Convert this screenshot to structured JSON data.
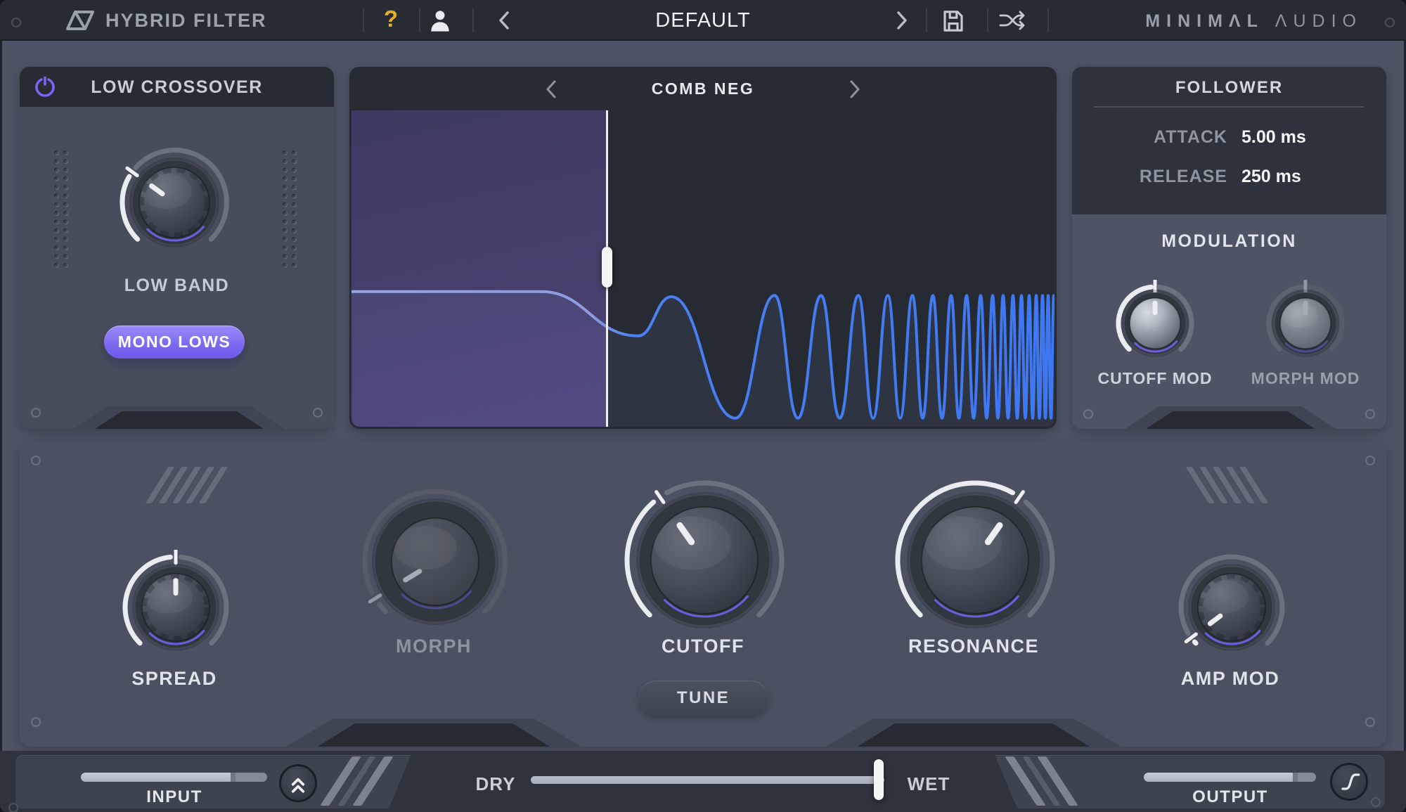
{
  "titlebar": {
    "app_title": "HYBRID FILTER",
    "help_label": "?",
    "preset_name": "DEFAULT",
    "brand_primary": "MINIMΛL",
    "brand_secondary": "ΛUDIO"
  },
  "left_panel": {
    "title": "LOW CROSSOVER",
    "button_label": "MONO LOWS"
  },
  "display": {
    "title": "COMB NEG",
    "curve": {
      "flat_y": 0.573,
      "flat_end_x": 0.27,
      "divider_x": 0.363,
      "dip": [
        0.408,
        0.713
      ],
      "bump": [
        0.455,
        0.589
      ],
      "first_trough_x": 0.546,
      "peak_y": 0.585,
      "trough_y": 0.973,
      "peaks_x": [
        0.602,
        0.668,
        0.721,
        0.763,
        0.798,
        0.827,
        0.853,
        0.875,
        0.895,
        0.912,
        0.927,
        0.941,
        0.953,
        0.964,
        0.974,
        0.983,
        0.991,
        0.999
      ],
      "handle_y": 0.495
    }
  },
  "follower": {
    "title": "FOLLOWER",
    "rows": [
      {
        "label": "ATTACK",
        "value": "5.00 ms"
      },
      {
        "label": "RELEASE",
        "value": "250 ms"
      }
    ]
  },
  "modulation": {
    "title": "MODULATION"
  },
  "main_panel": {
    "tune_label": "TUNE"
  },
  "knobs": {
    "low_band": {
      "label": "LOW BAND",
      "value": 0.3
    },
    "cutoff_mod": {
      "label": "CUTOFF MOD",
      "value": 0.5
    },
    "morph_mod": {
      "label": "MORPH MOD",
      "value": 0.5
    },
    "spread": {
      "label": "SPREAD",
      "value": 0.5
    },
    "morph": {
      "label": "MORPH",
      "value": 0.05
    },
    "cutoff": {
      "label": "CUTOFF",
      "value": 0.37
    },
    "resonance": {
      "label": "RESONANCE",
      "value": 0.63
    },
    "amp_mod": {
      "label": "AMP MOD",
      "value": 0.03
    }
  },
  "bottom_bar": {
    "input_label": "INPUT",
    "input_value": 0.82,
    "dry_label": "DRY",
    "wet_label": "WET",
    "mix_value": 0.985,
    "output_label": "OUTPUT",
    "output_value": 0.88
  },
  "colors": {
    "accent_purple": "#7264f2",
    "curve_blue": "#3f7af2",
    "curve_blue_left": "#99a4e2",
    "highlight_yellow": "#e7b01f"
  }
}
